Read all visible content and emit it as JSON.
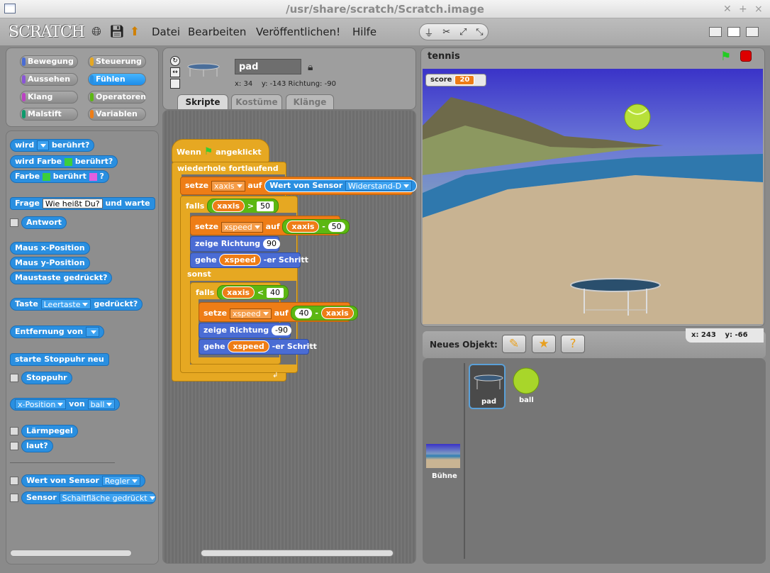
{
  "window": {
    "title": "/usr/share/scratch/Scratch.image"
  },
  "menu": {
    "logo": "SCRATCH",
    "items": [
      "Datei",
      "Bearbeiten",
      "Veröffentlichen!",
      "Hilfe"
    ]
  },
  "categories": [
    {
      "label": "Bewegung",
      "color": "#4a6cd4"
    },
    {
      "label": "Steuerung",
      "color": "#e6a822"
    },
    {
      "label": "Aussehen",
      "color": "#8a55d7"
    },
    {
      "label": "Fühlen",
      "color": "#2a8fe0",
      "selected": true
    },
    {
      "label": "Klang",
      "color": "#bb42c3"
    },
    {
      "label": "Operatoren",
      "color": "#5cb712"
    },
    {
      "label": "Malstift",
      "color": "#0e9a6c"
    },
    {
      "label": "Variablen",
      "color": "#ee7d16"
    }
  ],
  "palette": {
    "touching": "wird",
    "touching2": "berührt?",
    "touchingColor": "wird Farbe",
    "touchingColor2": "berührt?",
    "colorTouching": "Farbe",
    "colorTouching2": "berührt",
    "colorTouching3": "?",
    "ask": "Frage",
    "askDefault": "Wie heißt Du?",
    "ask2": "und warte",
    "answer": "Antwort",
    "mouseX": "Maus x-Position",
    "mouseY": "Maus y-Position",
    "mouseDown": "Maustaste gedrückt?",
    "key": "Taste",
    "keyDefault": "Leertaste",
    "key2": "gedrückt?",
    "distance": "Entfernung von",
    "resetTimer": "starte Stoppuhr neu",
    "timer": "Stoppuhr",
    "attrDD": "x-Position",
    "attrOf": "von",
    "attrObj": "ball",
    "loudness": "Lärmpegel",
    "loud": "laut?",
    "sensor": "Wert von Sensor",
    "sensorDD": "Regler",
    "sensorBool": "Sensor",
    "sensorBoolDD": "Schaltfläche gedrückt"
  },
  "sprite": {
    "name": "pad",
    "x": "x: 34",
    "y": "y: -143",
    "dir": "Richtung: -90"
  },
  "tabs": [
    "Skripte",
    "Kostüme",
    "Klänge"
  ],
  "script": {
    "hat": "Wenn",
    "hat2": "angeklickt",
    "forever": "wiederhole fortlaufend",
    "set1": "setze",
    "set1var": "xaxis",
    "set1to": "auf",
    "sensor": "Wert von Sensor",
    "sensorDD": "Widerstand-D",
    "if1": "falls",
    "if1var": "xaxis",
    "if1op": ">",
    "if1num": "50",
    "set2": "setze",
    "set2var": "xspeed",
    "set2to": "auf",
    "set2a": "xaxis",
    "set2op": "-",
    "set2b": "50",
    "point1": "zeige Richtung",
    "point1val": "90",
    "move1": "gehe",
    "move1var": "xspeed",
    "move1b": "-er Schritt",
    "else": "sonst",
    "if2": "falls",
    "if2var": "xaxis",
    "if2op": "<",
    "if2num": "40",
    "set3": "setze",
    "set3var": "xspeed",
    "set3to": "auf",
    "set3a": "40",
    "set3op": "-",
    "set3b": "xaxis",
    "point2": "zeige Richtung",
    "point2val": "-90",
    "move2": "gehe",
    "move2var": "xspeed",
    "move2b": "-er Schritt"
  },
  "stage": {
    "name": "tennis",
    "scoreLabel": "score",
    "scoreValue": "20",
    "mouseX": "x: 243",
    "mouseY": "y: -66"
  },
  "library": {
    "newObject": "Neues Objekt:",
    "sprites": [
      "pad",
      "ball"
    ],
    "stageLabel": "Bühne"
  }
}
